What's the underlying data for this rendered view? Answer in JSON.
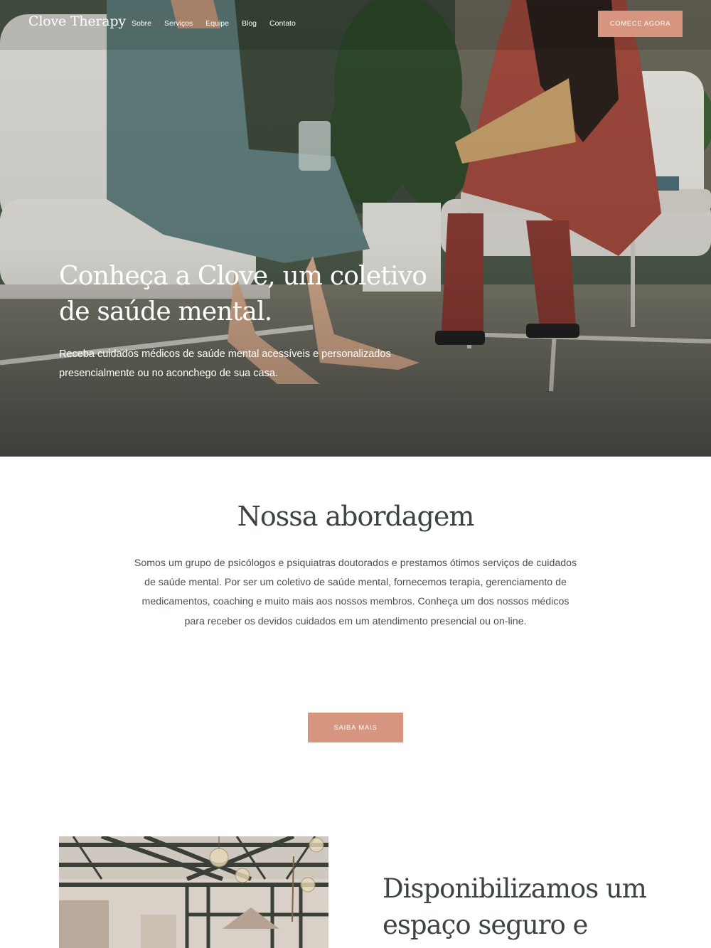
{
  "header": {
    "logo": "Clove Therapy",
    "nav": [
      "Sobre",
      "Serviços",
      "Equipe",
      "Blog",
      "Contato"
    ],
    "cta_label": "COMECE AGORA"
  },
  "hero": {
    "title": "Conheça a Clove, um coletivo de saúde mental.",
    "subtitle": "Receba cuidados médicos de saúde mental acessíveis e personalizados presencialmente ou no aconchego de sua casa."
  },
  "approach": {
    "title": "Nossa abordagem",
    "body": "Somos um grupo de psicólogos e psiquiatras doutorados e prestamos ótimos serviços de cuidados de saúde mental. Por ser um coletivo de saúde mental, fornecemos terapia, gerenciamento de medicamentos, coaching e muito mais aos nossos membros. Conheça um dos nossos médicos para receber os devidos cuidados em um atendimento presencial ou on-line.",
    "button_label": "SAIBA MAIS"
  },
  "safe_space": {
    "title": "Disponibilizamos um espaço seguro e"
  },
  "colors": {
    "accent": "#d5957f",
    "heading": "#3d4446",
    "body_text": "#4a5052"
  }
}
